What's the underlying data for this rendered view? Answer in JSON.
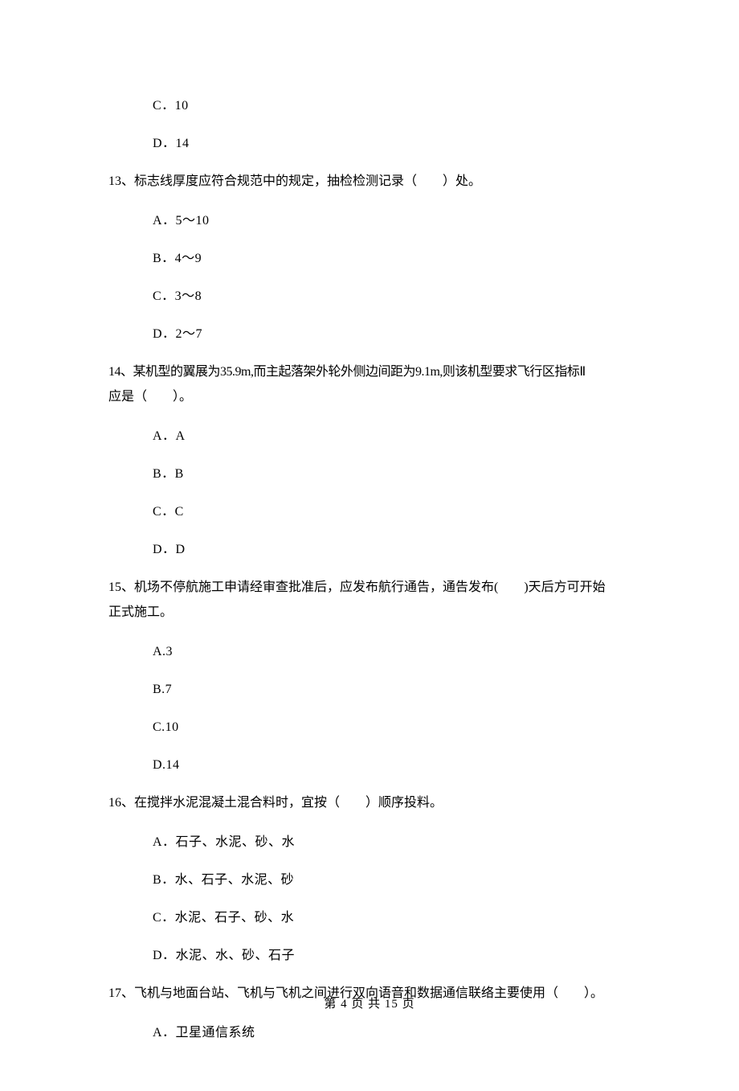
{
  "topOptions": {
    "c": "C．10",
    "d": "D．14"
  },
  "q13": {
    "text": "13、标志线厚度应符合规范中的规定，抽检检测记录（　　）处。",
    "a": "A．5～10",
    "b": "B．4～9",
    "c": "C．3～8",
    "d": "D．2～7"
  },
  "q14": {
    "line1": "14、某机型的翼展为35.9m,而主起落架外轮外侧边间距为9.1m,则该机型要求飞行区指标Ⅱ",
    "line2": "应是（　　）。",
    "a": "A．A",
    "b": "B．B",
    "c": "C．C",
    "d": "D．D"
  },
  "q15": {
    "line1": "15、机场不停航施工申请经审查批准后，应发布航行通告，通告发布(　　)天后方可开始",
    "line2": "正式施工。",
    "a": "A.3",
    "b": "B.7",
    "c": "C.10",
    "d": "D.14"
  },
  "q16": {
    "text": "16、在搅拌水泥混凝土混合料时，宜按（　　）顺序投料。",
    "a": "A．石子、水泥、砂、水",
    "b": "B．水、石子、水泥、砂",
    "c": "C．水泥、石子、砂、水",
    "d": "D．水泥、水、砂、石子"
  },
  "q17": {
    "text": "17、飞机与地面台站、飞机与飞机之间进行双向语音和数据通信联络主要使用（　　）。",
    "a": "A．卫星通信系统"
  },
  "footer": "第 4 页 共 15 页"
}
